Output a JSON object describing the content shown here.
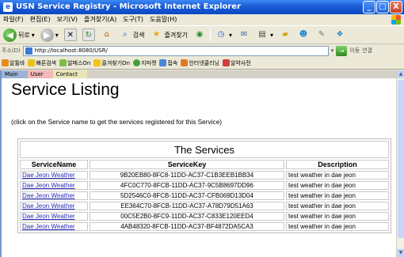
{
  "window": {
    "title": "USN Service Registry - Microsoft Internet Explorer",
    "controls": [
      "_",
      "□",
      "X"
    ]
  },
  "menu": [
    "파일(F)",
    "편집(E)",
    "보기(V)",
    "즐겨찾기(A)",
    "도구(T)",
    "도움말(H)"
  ],
  "toolbar": {
    "back_label": "뒤로",
    "search_label": "검색",
    "favorites_label": "즐겨찾기"
  },
  "address": {
    "label": "주소(D)",
    "url": "http://localhost:8080/USR/",
    "go_label": "이동",
    "links_label": "연결"
  },
  "links_bar": [
    "알툴바",
    "빠른검색",
    "알패스On",
    "즐겨찾기On",
    "지마켓",
    "접속",
    "인터넷클리닝",
    "알약사전"
  ],
  "nav": {
    "main": "Main",
    "user": "User",
    "contact": "Contact"
  },
  "page": {
    "heading": "Service Listing",
    "instruction": "(click on the Service name to get the services registered for this Service)"
  },
  "table": {
    "caption": "The Services",
    "headers": [
      "ServiceName",
      "ServiceKey",
      "Description"
    ],
    "rows": [
      [
        "Dae Jeon Weather",
        "9B20EB80-8FC8-11DD-AC37-C1B3EEB1BB34",
        "test weather in dae jeon"
      ],
      [
        "Dae Jeon Weather",
        "4FC0C770-8FCB-11DD-AC37-9C5B8697DD96",
        "test weather in dae jeon"
      ],
      [
        "Dae Jeon Weather",
        "5D2546C0-8FCB-11DD-AC37-CFB069D13D04",
        "test weather in dae jeon"
      ],
      [
        "Dae Jeon Weather",
        "EE364C70-8FCB-11DD-AC37-A78D79D51A63",
        "test weather in dae jeon"
      ],
      [
        "Dae Jeon Weather",
        "00C5E2B0-8FC9-11DD-AC37-C833E120EED4",
        "test weather in dae jeon"
      ],
      [
        "Dae Jeon Weather",
        "4AB48320-8FCB-11DD-AC37-BF4872DA5CA3",
        "test weather in dae jeon"
      ]
    ]
  }
}
